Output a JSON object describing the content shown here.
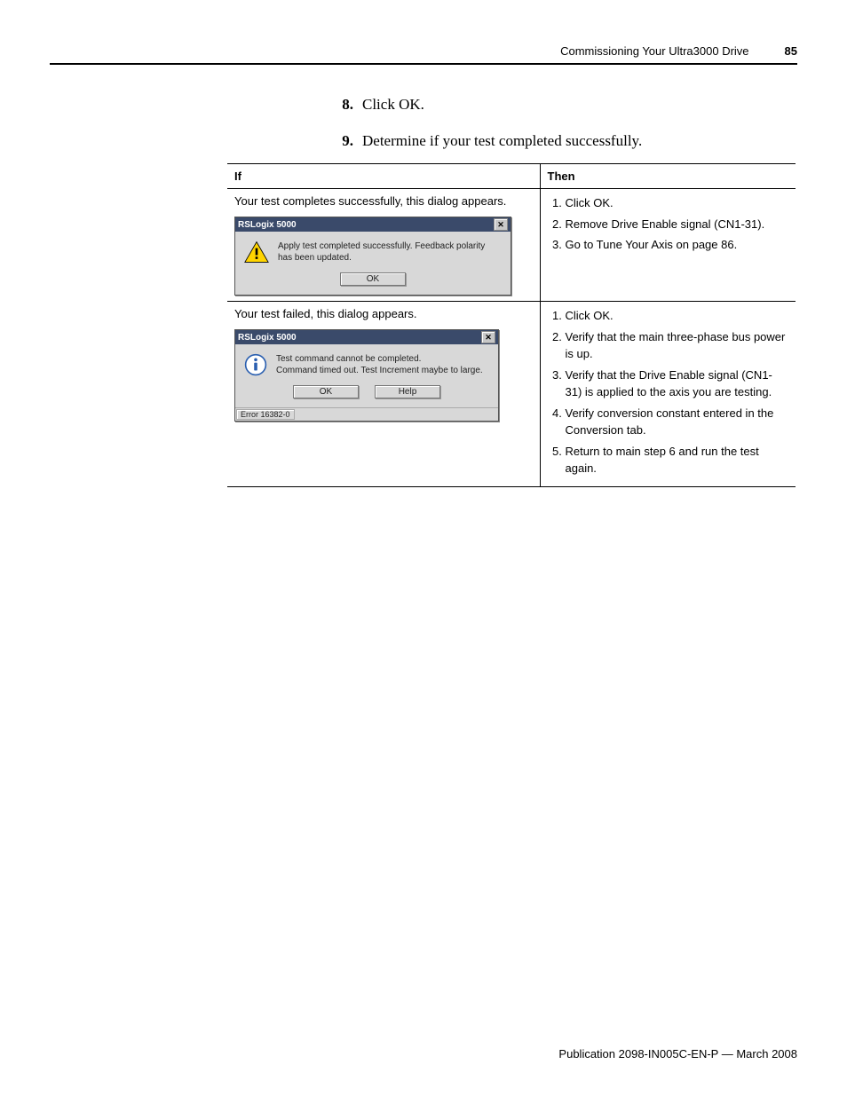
{
  "header": {
    "title": "Commissioning Your Ultra3000 Drive",
    "page_number": "85"
  },
  "steps": [
    {
      "num": "8.",
      "text": "Click OK."
    },
    {
      "num": "9.",
      "text": "Determine if your test completed successfully."
    }
  ],
  "table": {
    "head_if": "If",
    "head_then": "Then",
    "rows": [
      {
        "if_text": "Your test completes successfully, this dialog appears.",
        "dialog": {
          "title": "RSLogix 5000",
          "message": "Apply test completed successfully. Feedback polarity has been updated.",
          "icon": "warning",
          "buttons": [
            "OK"
          ],
          "status": null
        },
        "then": [
          "Click OK.",
          "Remove Drive Enable signal (CN1-31).",
          "Go to Tune Your Axis on page 86."
        ]
      },
      {
        "if_text": "Your test failed, this dialog appears.",
        "dialog": {
          "title": "RSLogix 5000",
          "message": "Test command cannot be completed.\nCommand timed out. Test Increment maybe to large.",
          "icon": "info",
          "buttons": [
            "OK",
            "Help"
          ],
          "status": "Error 16382-0"
        },
        "then": [
          "Click OK.",
          "Verify that the main three-phase bus power is up.",
          "Verify that the Drive Enable signal (CN1-31) is applied to the axis you are testing.",
          "Verify conversion constant entered in the Conversion tab.",
          "Return to main step 6 and run the test again."
        ]
      }
    ]
  },
  "footer": "Publication 2098-IN005C-EN-P — March 2008"
}
